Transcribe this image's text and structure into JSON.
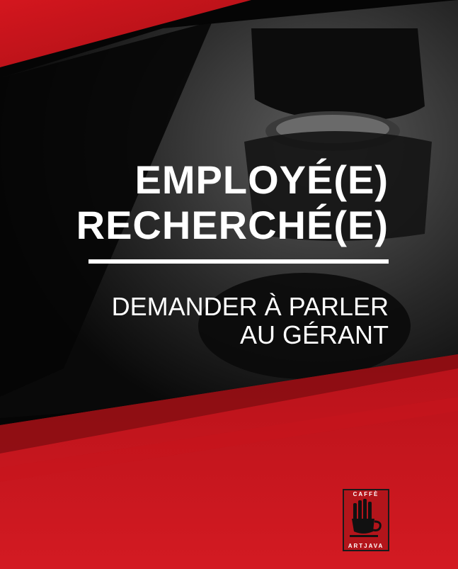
{
  "headline": {
    "line1": "EMPLOYÉ(E)",
    "line2": "RECHERCHÉ(E)"
  },
  "subline": {
    "line1": "DEMANDER À PARLER",
    "line2": "AU GÉRANT"
  },
  "logo": {
    "top_text": "CAFFÈ",
    "bottom_text": "ARTJAVA"
  },
  "colors": {
    "brand_red": "#c8141c",
    "dark_red": "#8e0d12",
    "text": "#ffffff",
    "background": "#000000"
  }
}
